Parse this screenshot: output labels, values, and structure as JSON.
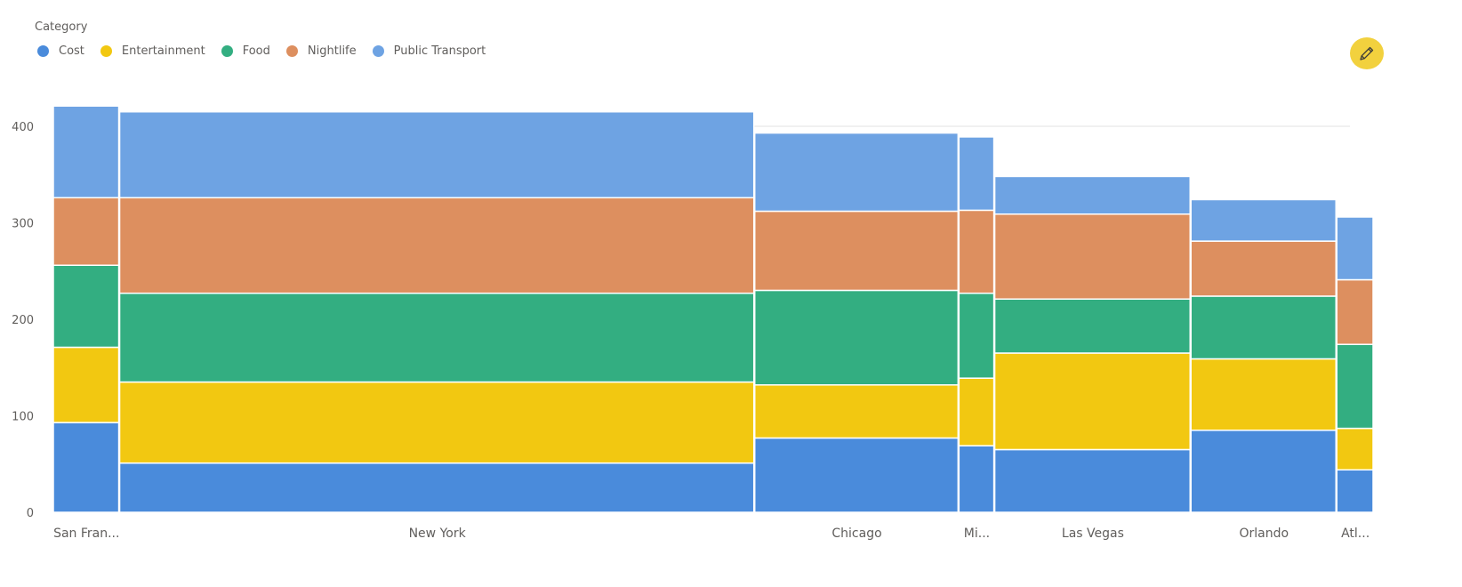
{
  "chart_data": {
    "type": "bar",
    "subtype": "marimekko-stacked",
    "legend_title": "Category",
    "legend_position": "top-left",
    "grid": true,
    "ylim": [
      0,
      420
    ],
    "yticks": [
      0,
      100,
      200,
      300,
      400
    ],
    "categories": [
      "San Fran...",
      "New York",
      "Chicago",
      "Mi...",
      "Las Vegas",
      "Orlando",
      "Atl..."
    ],
    "width_share_percent": [
      5.0,
      47.9,
      15.4,
      2.7,
      14.8,
      11.0,
      2.8
    ],
    "series": [
      {
        "name": "Cost",
        "color": "#4a8bdb",
        "values": [
          93,
          51,
          77,
          69,
          65,
          85,
          44
        ]
      },
      {
        "name": "Entertainment",
        "color": "#f2c811",
        "values": [
          78,
          84,
          55,
          70,
          100,
          74,
          43
        ]
      },
      {
        "name": "Food",
        "color": "#33ae81",
        "values": [
          85,
          92,
          98,
          88,
          56,
          65,
          87
        ]
      },
      {
        "name": "Nightlife",
        "color": "#dd8f5f",
        "values": [
          70,
          99,
          82,
          86,
          88,
          57,
          67
        ]
      },
      {
        "name": "Public Transport",
        "color": "#6ea3e3",
        "values": [
          95,
          89,
          81,
          76,
          39,
          43,
          65
        ]
      }
    ]
  },
  "toolbar": {
    "edit_icon": "pencil-icon",
    "edit_color": "#f2d13e"
  }
}
